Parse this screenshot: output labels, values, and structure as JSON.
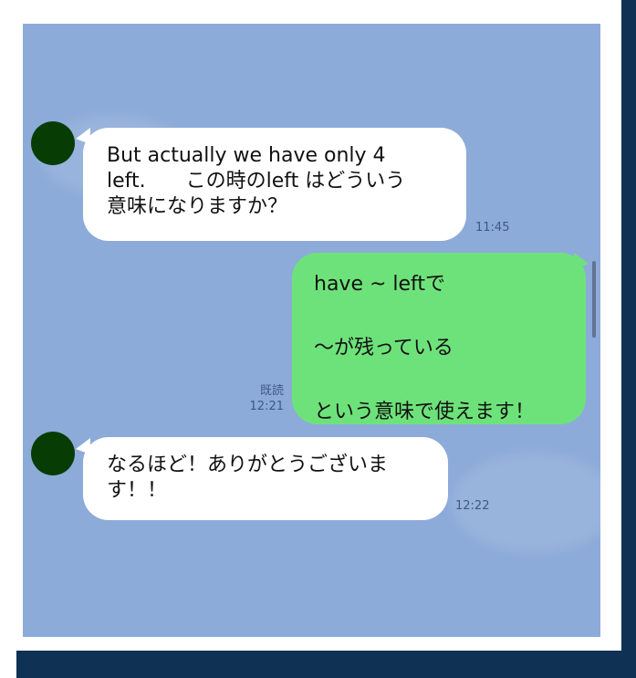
{
  "colors": {
    "chat_background": "#8dabd9",
    "incoming_bubble": "#ffffff",
    "outgoing_bubble": "#6ee27a",
    "avatar": "#073d04",
    "frame": "#0f3154"
  },
  "messages": [
    {
      "direction": "incoming",
      "lines": [
        "But actually we have only 4",
        "left.　　この時のleft はどういう",
        "意味になりますか？"
      ],
      "time": "11:45"
    },
    {
      "direction": "outgoing",
      "lines": [
        "have ~ leftで",
        "",
        "〜が残っている",
        "",
        "という意味で使えます！"
      ],
      "read_label": "既読",
      "time": "12:21"
    },
    {
      "direction": "incoming",
      "lines": [
        "なるほど！ありがとうございま",
        "す！！"
      ],
      "time": "12:22"
    }
  ]
}
